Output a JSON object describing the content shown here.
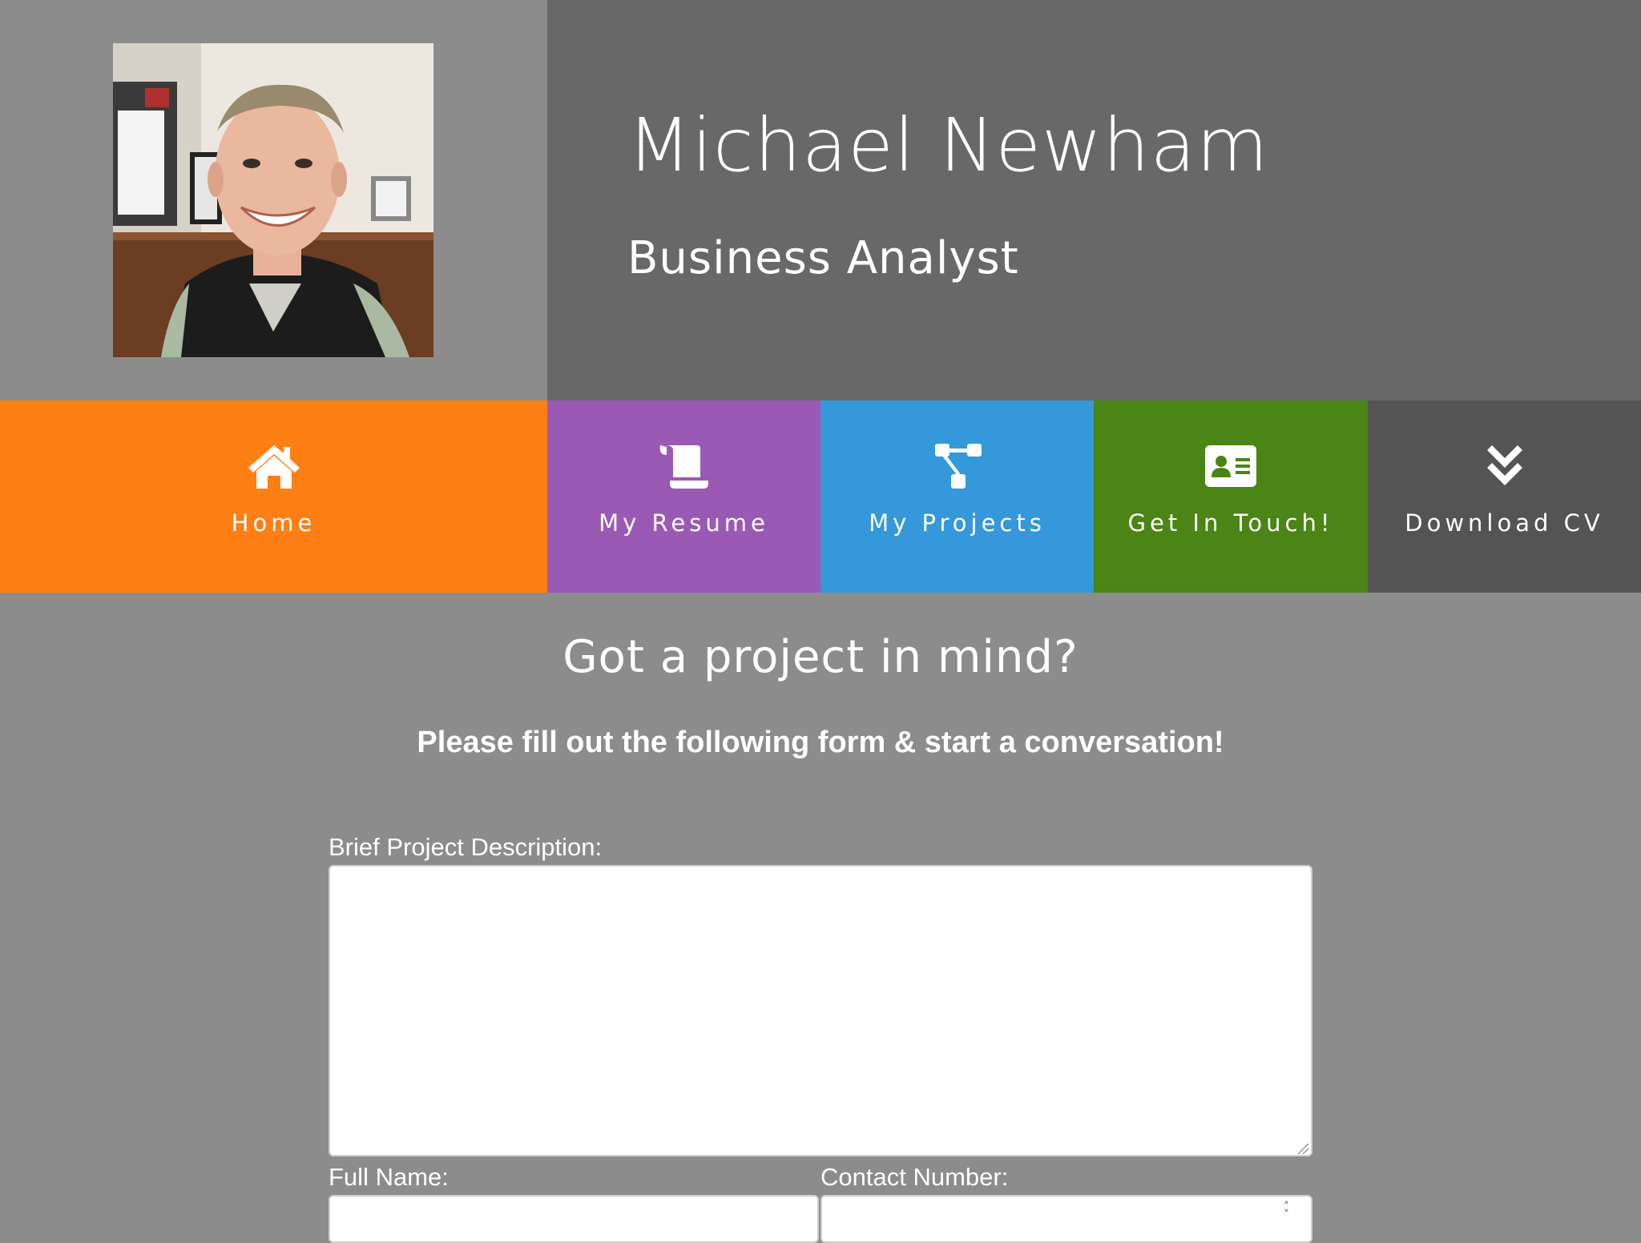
{
  "header": {
    "name": "Michael Newham",
    "title": "Business Analyst"
  },
  "nav": {
    "items": [
      {
        "label": "Home",
        "icon": "home-icon",
        "color": "#fe7f14"
      },
      {
        "label": "My Resume",
        "icon": "scroll-icon",
        "color": "#9b59b6"
      },
      {
        "label": "My Projects",
        "icon": "sitemap-icon",
        "color": "#3498db"
      },
      {
        "label": "Get In Touch!",
        "icon": "contact-card-icon",
        "color": "#4a8515"
      },
      {
        "label": "Download CV",
        "icon": "double-chevron-down-icon",
        "color": "#545454"
      }
    ]
  },
  "contact": {
    "heading": "Got a project in mind?",
    "subheading": "Please fill out the following form & start a conversation!",
    "description_label": "Brief Project Description:",
    "description_value": "",
    "fullname_label": "Full Name:",
    "fullname_value": "",
    "contact_label": "Contact Number:",
    "contact_value": ""
  },
  "colors": {
    "page_background": "#8c8c8c",
    "name_panel": "#686868"
  }
}
